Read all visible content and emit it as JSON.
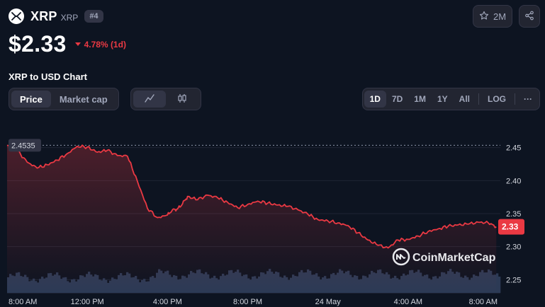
{
  "coin": {
    "name": "XRP",
    "symbol": "XRP",
    "rank": "#4",
    "price": "$2.33",
    "change": "4.78% (1d)",
    "change_direction": "down",
    "watchlist_count": "2M"
  },
  "icons": {
    "logo": "xrp-logo-icon",
    "watch": "star-icon",
    "share": "share-icon",
    "line_chart": "line-chart-icon",
    "candle_chart": "candlestick-icon",
    "more": "more-dots-icon"
  },
  "chart_title": "XRP to USD Chart",
  "chart_type_tabs": [
    "Price",
    "Market cap"
  ],
  "active_chart_type": "Price",
  "range_tabs": [
    "1D",
    "7D",
    "1M",
    "1Y",
    "All"
  ],
  "active_range": "1D",
  "log_label": "LOG",
  "more_label": "···",
  "watermark": "CoinMarketCap",
  "colors": {
    "background": "#0d1421",
    "line": "#ea3943",
    "accent_red": "#ea3943",
    "panel": "#222531",
    "volume": "#2c3a55"
  },
  "chart_data": {
    "type": "line",
    "title": "XRP to USD Chart",
    "xlabel": "",
    "ylabel": "",
    "x_tick_labels": [
      "8:00 AM",
      "12:00 PM",
      "4:00 PM",
      "8:00 PM",
      "24 May",
      "4:00 AM",
      "8:00 AM"
    ],
    "y_tick_labels": [
      "2.45",
      "2.40",
      "2.35",
      "2.30",
      "2.25"
    ],
    "y_ticks": [
      2.45,
      2.4,
      2.35,
      2.3,
      2.25
    ],
    "ylim": [
      2.23,
      2.485
    ],
    "open_price": 2.4535,
    "open_label": "2.4535",
    "current_price": 2.33,
    "current_label": "2.33",
    "x_hours": [
      0,
      0.5,
      1,
      1.5,
      2,
      2.5,
      3,
      3.5,
      4,
      4.5,
      5,
      5.5,
      6,
      6.5,
      7,
      7.5,
      8,
      8.25,
      8.5,
      8.75,
      9,
      9.5,
      10,
      10.5,
      11,
      11.5,
      12,
      12.5,
      13,
      13.5,
      14,
      14.5,
      15,
      15.5,
      16,
      16.5,
      17,
      17.5,
      18,
      18.5,
      19,
      19.5,
      20,
      20.5,
      21,
      21.5,
      22,
      22.5,
      23,
      23.5,
      24,
      24.4
    ],
    "prices": [
      2.4535,
      2.446,
      2.428,
      2.419,
      2.424,
      2.431,
      2.441,
      2.452,
      2.451,
      2.443,
      2.446,
      2.438,
      2.437,
      2.399,
      2.358,
      2.344,
      2.348,
      2.356,
      2.357,
      2.365,
      2.376,
      2.371,
      2.378,
      2.374,
      2.367,
      2.359,
      2.364,
      2.369,
      2.366,
      2.363,
      2.361,
      2.356,
      2.349,
      2.341,
      2.339,
      2.336,
      2.332,
      2.321,
      2.31,
      2.302,
      2.298,
      2.31,
      2.311,
      2.316,
      2.323,
      2.327,
      2.331,
      2.333,
      2.334,
      2.337,
      2.336,
      2.33
    ]
  }
}
